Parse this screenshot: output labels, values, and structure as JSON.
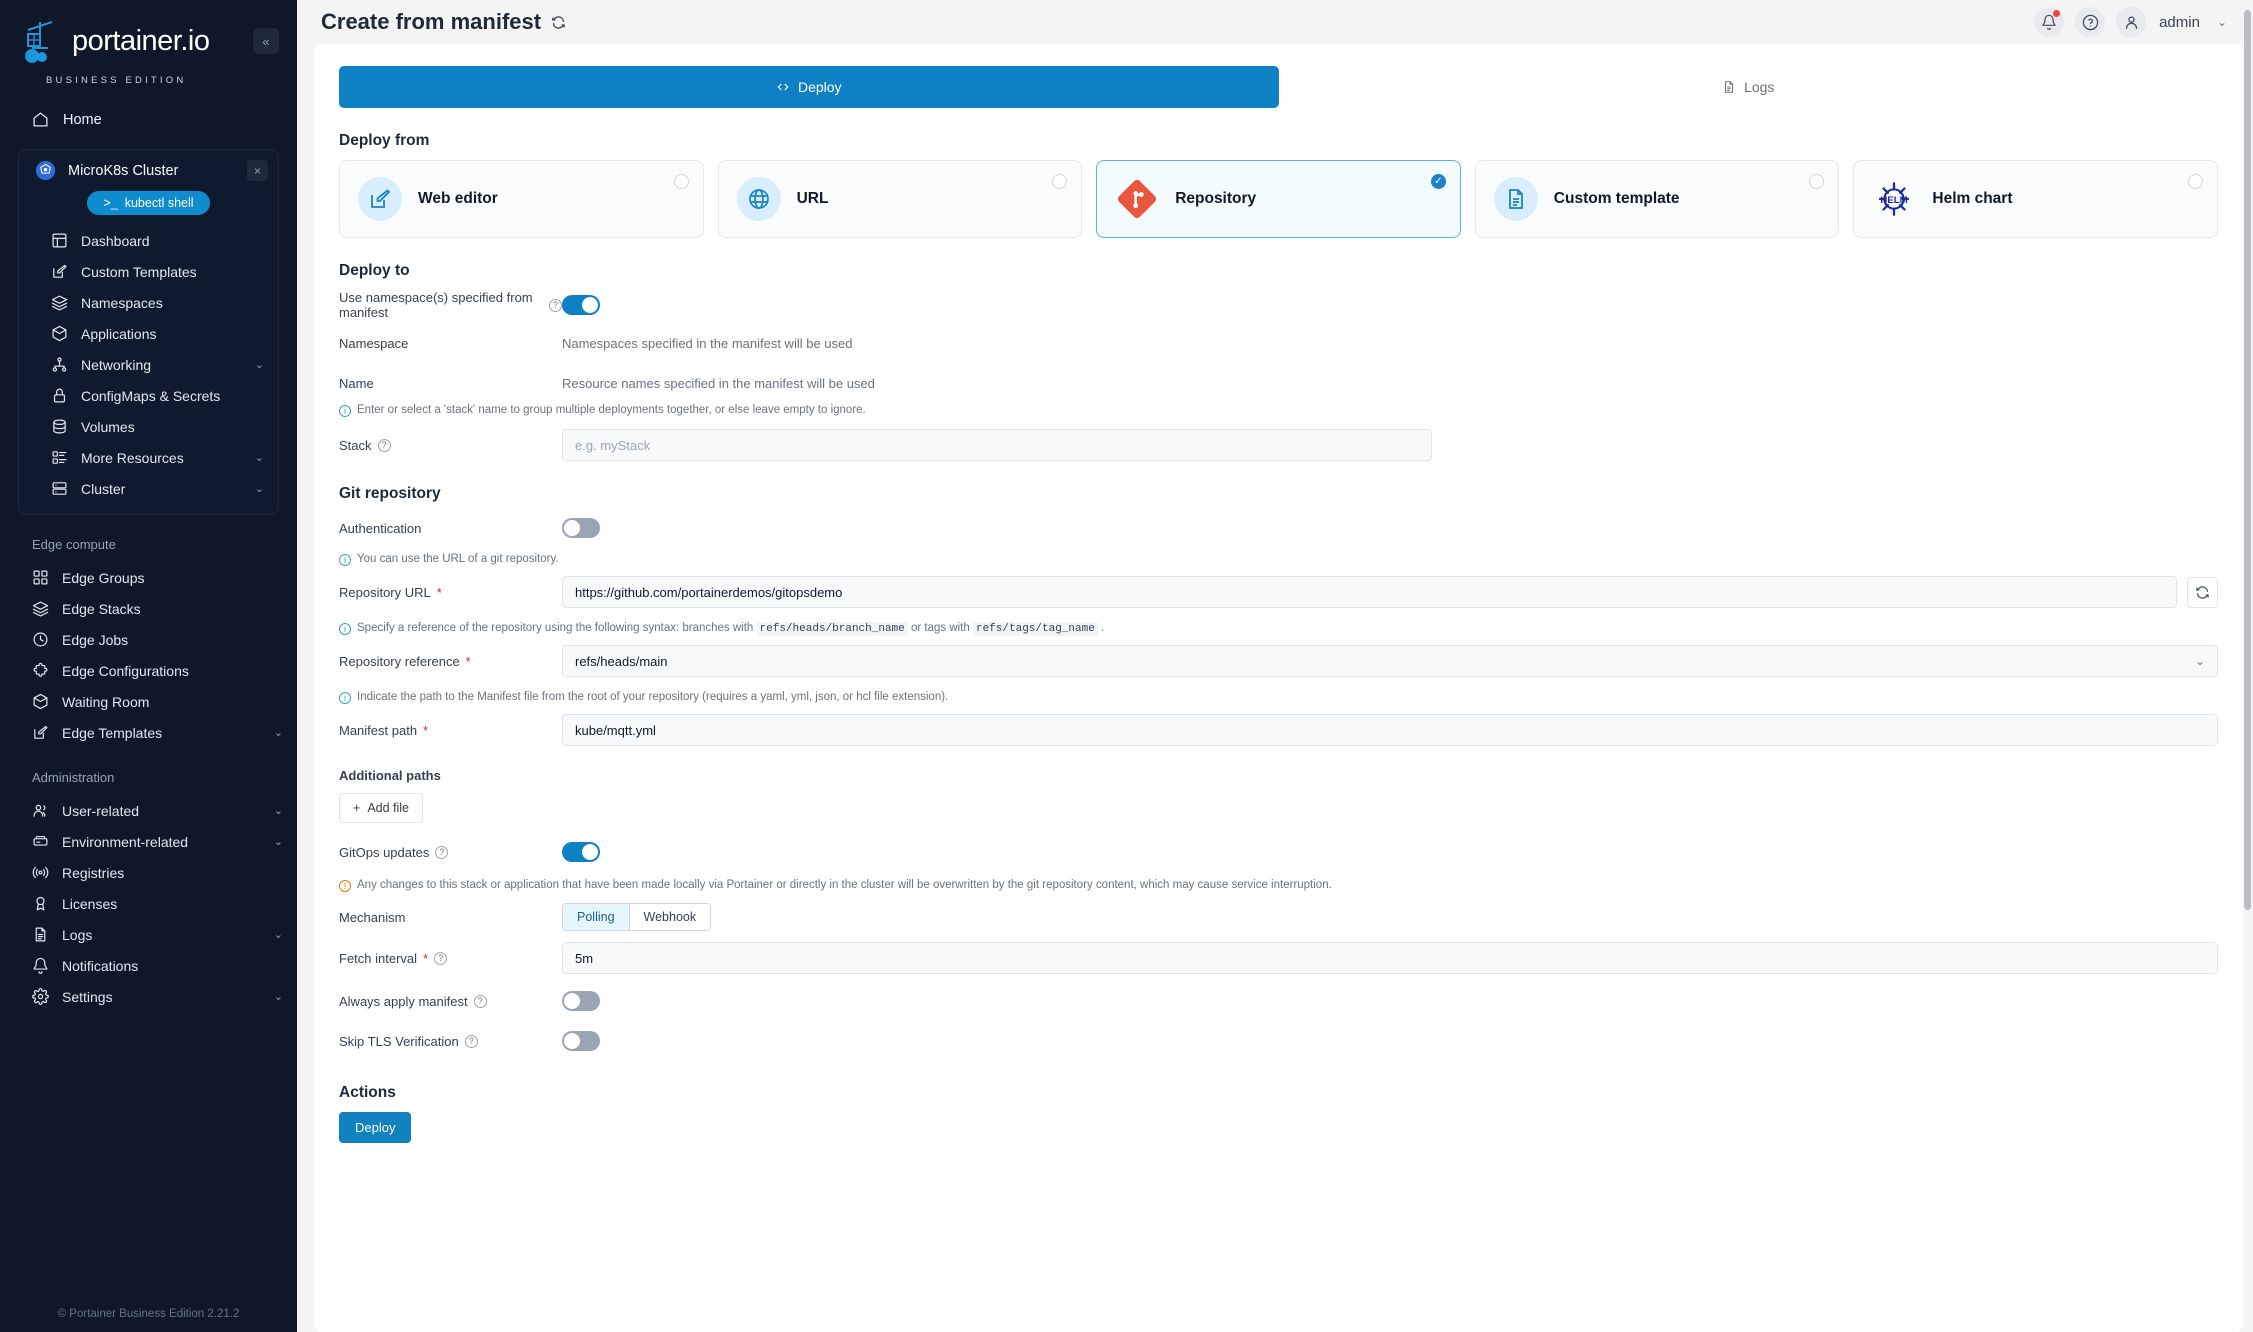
{
  "sidebar": {
    "logo": {
      "title": "portainer.io",
      "subtitle": "BUSINESS EDITION"
    },
    "collapse_label": "«",
    "home": {
      "label": "Home",
      "icon": "home-icon"
    },
    "environment": {
      "name": "MicroK8s Cluster",
      "close_label": "×",
      "shell_button": "kubectl shell",
      "shell_icon": ">_",
      "items": [
        {
          "label": "Dashboard",
          "icon": "dashboard-icon",
          "chevron": false
        },
        {
          "label": "Custom Templates",
          "icon": "edit-square-icon",
          "chevron": false
        },
        {
          "label": "Namespaces",
          "icon": "layers-icon",
          "chevron": false
        },
        {
          "label": "Applications",
          "icon": "box-icon",
          "chevron": false
        },
        {
          "label": "Networking",
          "icon": "network-icon",
          "chevron": true
        },
        {
          "label": "ConfigMaps & Secrets",
          "icon": "lock-icon",
          "chevron": false
        },
        {
          "label": "Volumes",
          "icon": "database-icon",
          "chevron": false
        },
        {
          "label": "More Resources",
          "icon": "list-icon",
          "chevron": true
        },
        {
          "label": "Cluster",
          "icon": "server-icon",
          "chevron": true
        }
      ]
    },
    "sections": [
      {
        "title": "Edge compute",
        "items": [
          {
            "label": "Edge Groups",
            "icon": "grid-icon",
            "chevron": false
          },
          {
            "label": "Edge Stacks",
            "icon": "layers-icon",
            "chevron": false
          },
          {
            "label": "Edge Jobs",
            "icon": "clock-icon",
            "chevron": false
          },
          {
            "label": "Edge Configurations",
            "icon": "puzzle-icon",
            "chevron": false
          },
          {
            "label": "Waiting Room",
            "icon": "box-icon",
            "chevron": false
          },
          {
            "label": "Edge Templates",
            "icon": "edit-square-icon",
            "chevron": true
          }
        ]
      },
      {
        "title": "Administration",
        "items": [
          {
            "label": "User-related",
            "icon": "users-icon",
            "chevron": true
          },
          {
            "label": "Environment-related",
            "icon": "environment-icon",
            "chevron": true
          },
          {
            "label": "Registries",
            "icon": "radio-icon",
            "chevron": false
          },
          {
            "label": "Licenses",
            "icon": "award-icon",
            "chevron": false
          },
          {
            "label": "Logs",
            "icon": "file-text-icon",
            "chevron": true
          },
          {
            "label": "Notifications",
            "icon": "bell-icon",
            "chevron": false
          },
          {
            "label": "Settings",
            "icon": "gear-icon",
            "chevron": true
          }
        ]
      }
    ],
    "footer": "© Portainer Business Edition  2.21.2"
  },
  "header": {
    "title": "Create from manifest",
    "refresh_icon": "refresh-icon",
    "notifications_icon": "bell-icon",
    "help_icon": "help-circle-icon",
    "user_icon": "user-icon",
    "user_name": "admin",
    "user_chevron": "⌄"
  },
  "tabs": [
    {
      "label": "Deploy",
      "icon": "code-icon",
      "active": true
    },
    {
      "label": "Logs",
      "icon": "file-text-icon",
      "active": false
    }
  ],
  "deploy_from": {
    "title": "Deploy from",
    "options": [
      {
        "label": "Web editor",
        "icon": "edit-square-icon",
        "selected": false
      },
      {
        "label": "URL",
        "icon": "globe-icon",
        "selected": false
      },
      {
        "label": "Repository",
        "icon": "git-icon",
        "selected": true
      },
      {
        "label": "Custom template",
        "icon": "file-icon",
        "selected": false
      },
      {
        "label": "Helm chart",
        "icon": "helm-icon",
        "selected": false
      }
    ],
    "check_glyph": "✓"
  },
  "deploy_to": {
    "title": "Deploy to",
    "use_namespace_label": "Use namespace(s) specified from manifest",
    "use_namespace_on": true,
    "namespace_label": "Namespace",
    "namespace_value": "Namespaces specified in the manifest will be used",
    "name_label": "Name",
    "name_value": "Resource names specified in the manifest will be used",
    "stack_hint": "Enter or select a 'stack' name to group multiple deployments together, or else leave empty to ignore.",
    "stack_label": "Stack",
    "stack_placeholder": "e.g. myStack",
    "stack_value": ""
  },
  "git_repository": {
    "title": "Git repository",
    "authentication_label": "Authentication",
    "authentication_on": false,
    "url_hint": "You can use the URL of a git repository.",
    "url_label": "Repository URL",
    "url_required": "*",
    "url_value": "https://github.com/portainerdemos/gitopsdemo",
    "refresh_icon": "refresh-icon",
    "ref_hint_pre": "Specify a reference of the repository using the following syntax: branches with",
    "ref_hint_code1": "refs/heads/branch_name",
    "ref_hint_mid": "or tags with",
    "ref_hint_code2": "refs/tags/tag_name",
    "ref_hint_post": ".",
    "ref_label": "Repository reference",
    "ref_required": "*",
    "ref_value": "refs/heads/main",
    "ref_chevron": "⌄",
    "manifest_hint": "Indicate the path to the Manifest file from the root of your repository (requires a yaml, yml, json, or hcl file extension).",
    "manifest_label": "Manifest path",
    "manifest_required": "*",
    "manifest_value": "kube/mqtt.yml",
    "additional_paths_title": "Additional paths",
    "add_file_label": "Add file",
    "add_file_icon": "plus-icon",
    "gitops_label": "GitOps updates",
    "gitops_on": true,
    "gitops_warning": "Any changes to this stack or application that have been made locally via Portainer or directly in the cluster will be overwritten by the git repository content, which may cause service interruption.",
    "mechanism_label": "Mechanism",
    "mechanism_options": [
      "Polling",
      "Webhook"
    ],
    "mechanism_selected": "Polling",
    "fetch_label": "Fetch interval",
    "fetch_required": "*",
    "fetch_value": "5m",
    "always_apply_label": "Always apply manifest",
    "always_apply_on": false,
    "skip_tls_label": "Skip TLS Verification",
    "skip_tls_on": false
  },
  "actions": {
    "title": "Actions",
    "deploy_label": "Deploy"
  }
}
